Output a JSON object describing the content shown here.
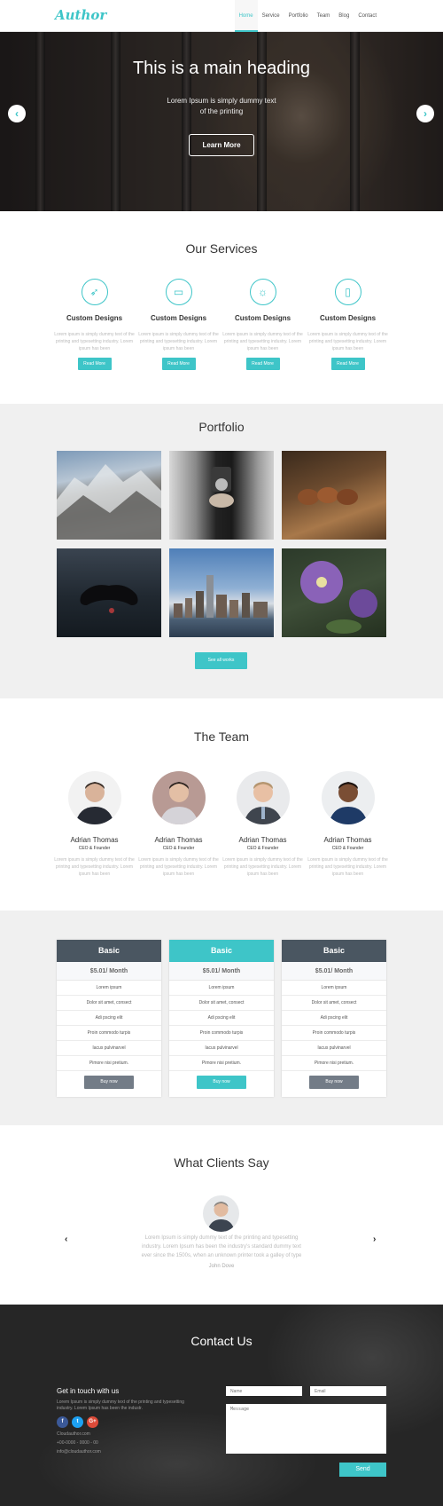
{
  "nav": {
    "logo": "Author",
    "items": [
      "Home",
      "Service",
      "Portfolio",
      "Team",
      "Blog",
      "Contact"
    ],
    "active": "Home"
  },
  "hero": {
    "heading": "This is a main heading",
    "text": "Lorem Ipsum is simply dummy text of the printing",
    "button": "Learn More",
    "prev_icon": "chevron-left-icon",
    "next_icon": "chevron-right-icon"
  },
  "services": {
    "title": "Our Services",
    "items": [
      {
        "icon": "rocket-icon",
        "title": "Custom Designs",
        "text": "Lorem ipsum is simply dummy text of the printing and typesetting industry. Lorem ipsum has been",
        "button": "Read More"
      },
      {
        "icon": "monitor-icon",
        "title": "Custom Designs",
        "text": "Lorem ipsum is simply dummy text of the printing and typesetting industry. Lorem ipsum has been",
        "button": "Read More"
      },
      {
        "icon": "lightbulb-icon",
        "title": "Custom Designs",
        "text": "Lorem ipsum is simply dummy text of the printing and typesetting industry. Lorem ipsum has been",
        "button": "Read More"
      },
      {
        "icon": "mobile-icon",
        "title": "Custom Designs",
        "text": "Lorem ipsum is simply dummy text of the printing and typesetting industry. Lorem ipsum has been",
        "button": "Read More"
      }
    ]
  },
  "portfolio": {
    "title": "Portfolio",
    "button": "See all works",
    "images": [
      "mountains",
      "camera",
      "mushrooms",
      "gamepad",
      "city-skyline",
      "purple-flower"
    ]
  },
  "team": {
    "title": "The Team",
    "members": [
      {
        "name": "Adrian Thomas",
        "role": "CEO & Founder",
        "text": "Lorem ipsum is simply dummy text of the printing and typesetting industry. Lorem ipsum has been"
      },
      {
        "name": "Adrian Thomas",
        "role": "CEO & Founder",
        "text": "Lorem ipsum is simply dummy text of the printing and typesetting industry. Lorem ipsum has been"
      },
      {
        "name": "Adrian Thomas",
        "role": "CEO & Founder",
        "text": "Lorem ipsum is simply dummy text of the printing and typesetting industry. Lorem ipsum has been"
      },
      {
        "name": "Adrian Thomas",
        "role": "CEO & Founder",
        "text": "Lorem ipsum is simply dummy text of the printing and typesetting industry. Lorem ipsum has been"
      }
    ]
  },
  "pricing": {
    "plans": [
      {
        "name": "Basic",
        "price": "$5.01/ Month",
        "features": [
          "Lorem ipsum",
          "Dolor sit amet, consect",
          "Adi pscing elit",
          "Proin commodo turpis",
          "Iacus pulvinarvel",
          "Pimore nisi pretium."
        ],
        "button": "Buy now"
      },
      {
        "name": "Basic",
        "price": "$5.01/ Month",
        "features": [
          "Lorem ipsum",
          "Dolor sit amet, consect",
          "Adi pscing elit",
          "Proin commodo turpis",
          "Iacus pulvinarvel",
          "Pimore nisi pretium."
        ],
        "button": "Buy now"
      },
      {
        "name": "Basic",
        "price": "$5.01/ Month",
        "features": [
          "Lorem ipsum",
          "Dolor sit amet, consect",
          "Adi pscing elit",
          "Proin commodo turpis",
          "Iacus pulvinarvel",
          "Pimore nisi pretium."
        ],
        "button": "Buy now"
      }
    ]
  },
  "testimonials": {
    "title": "What Clients Say",
    "text": "Lorem Ipsum is simply dummy text of the printing and typesetting industry. Lorem Ipsum has been the industry's standard dummy text ever since the 1500s, when an unknown printer took a galley of type",
    "name": "John Dove"
  },
  "contact": {
    "title": "Contact Us",
    "subtitle": "Get in touch with us",
    "text": "Lorem Ipsum is simply dummy text of the printing and typesetting industry. Lorem Ipsum has been the industr.",
    "social": [
      "f",
      "t",
      "G+"
    ],
    "website": "Cloudauthor.com",
    "phone": "+00-0000 - 0000 - 00",
    "email": "info@cloudauthor.com",
    "name_placeholder": "Name",
    "email_placeholder": "Email",
    "message_placeholder": "Message",
    "send": "Send"
  },
  "colors": {
    "accent": "#3ec5c8",
    "dark": "#4a5661",
    "facebook": "#3b5998",
    "twitter": "#1da1f2",
    "google": "#dd4b39"
  }
}
